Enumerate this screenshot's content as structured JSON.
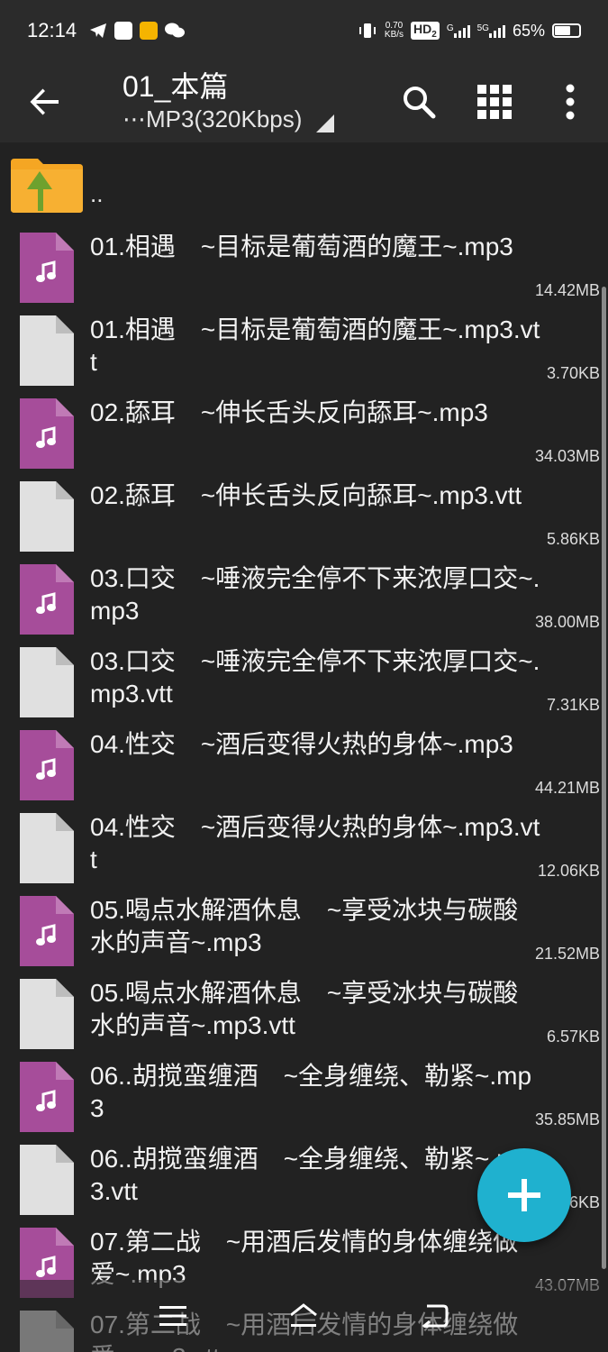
{
  "status": {
    "time": "12:14",
    "net_speed_value": "0.70",
    "net_speed_unit": "KB/s",
    "hd": "HD",
    "hd_sub": "2",
    "sig1": "G",
    "sig2": "5G",
    "battery_percent": "65%",
    "battery_level": 0.65
  },
  "toolbar": {
    "title": "01_本篇",
    "subtitle": "⋯MP3(320Kbps)"
  },
  "parent": {
    "label": ".."
  },
  "files": [
    {
      "name": "01.相遇　~目标是葡萄酒的魔王~.mp3",
      "size": "14.42MB",
      "type": "audio"
    },
    {
      "name": "01.相遇　~目标是葡萄酒的魔王~.mp3.vtt",
      "size": "3.70KB",
      "type": "text"
    },
    {
      "name": "02.舔耳　~伸长舌头反向舔耳~.mp3",
      "size": "34.03MB",
      "type": "audio"
    },
    {
      "name": "02.舔耳　~伸长舌头反向舔耳~.mp3.vtt",
      "size": "5.86KB",
      "type": "text"
    },
    {
      "name": "03.口交　~唾液完全停不下来浓厚口交~.mp3",
      "size": "38.00MB",
      "type": "audio"
    },
    {
      "name": "03.口交　~唾液完全停不下来浓厚口交~.mp3.vtt",
      "size": "7.31KB",
      "type": "text"
    },
    {
      "name": "04.性交　~酒后变得火热的身体~.mp3",
      "size": "44.21MB",
      "type": "audio"
    },
    {
      "name": "04.性交　~酒后变得火热的身体~.mp3.vtt",
      "size": "12.06KB",
      "type": "text"
    },
    {
      "name": "05.喝点水解酒休息　~享受冰块与碳酸水的声音~.mp3",
      "size": "21.52MB",
      "type": "audio"
    },
    {
      "name": "05.喝点水解酒休息　~享受冰块与碳酸水的声音~.mp3.vtt",
      "size": "6.57KB",
      "type": "text"
    },
    {
      "name": "06..胡搅蛮缠酒　~全身缠绕、勒紧~.mp3",
      "size": "35.85MB",
      "type": "audio"
    },
    {
      "name": "06..胡搅蛮缠酒　~全身缠绕、勒紧~.mp3.vtt",
      "size": "5.86KB",
      "type": "text"
    },
    {
      "name": "07.第二战　~用酒后发情的身体缠绕做爱~.mp3",
      "size": "43.07MB",
      "type": "audio"
    },
    {
      "name": "07.第二战　~用酒后发情的身体缠绕做爱~.mp3.vtt",
      "size": "",
      "type": "text"
    }
  ],
  "colors": {
    "audio_icon": "#a64d9a",
    "text_icon": "#e0e0e0",
    "fab": "#1fb1cf",
    "folder": "#f5a623",
    "folder_arrow": "#6ea12e"
  },
  "icons": {
    "back": "arrow-left-icon",
    "search": "search-icon",
    "grid": "grid-view-icon",
    "menu": "more-vert-icon",
    "fab": "plus-icon"
  }
}
